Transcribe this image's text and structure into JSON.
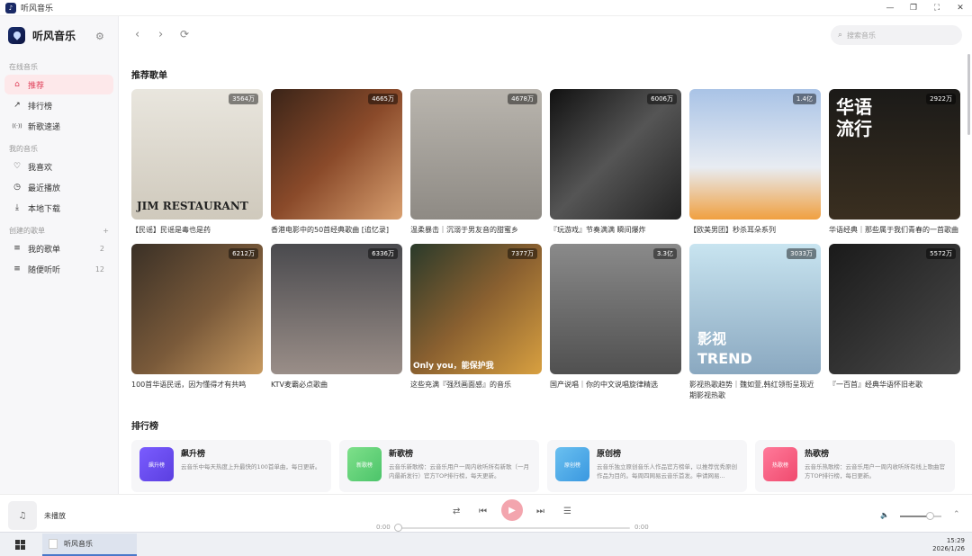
{
  "window": {
    "title": "听风音乐",
    "controls": [
      "—",
      "❐",
      "⛶",
      "✕"
    ]
  },
  "app": {
    "name": "听风音乐"
  },
  "sidebar": {
    "sections": [
      {
        "label": "在线音乐",
        "items": [
          {
            "label": "推荐",
            "icon": "home-icon",
            "active": true
          },
          {
            "label": "排行榜",
            "icon": "trend-icon"
          },
          {
            "label": "新歌速递",
            "icon": "broadcast-icon"
          }
        ]
      },
      {
        "label": "我的音乐",
        "items": [
          {
            "label": "我喜欢",
            "icon": "heart-icon"
          },
          {
            "label": "最近播放",
            "icon": "clock-icon"
          },
          {
            "label": "本地下载",
            "icon": "download-icon"
          }
        ]
      },
      {
        "label": "创建的歌单",
        "add": "+",
        "items": [
          {
            "label": "我的歌单",
            "icon": "playlist-icon",
            "count": "2"
          },
          {
            "label": "随便听听",
            "icon": "playlist-icon",
            "count": "12"
          }
        ]
      }
    ]
  },
  "search": {
    "placeholder": "搜索音乐"
  },
  "recommend": {
    "title": "推荐歌单",
    "row1": [
      {
        "title": "【民谣】民谣是毒也是药",
        "plays": "3564万",
        "overlay": "JIM RESTAURANT",
        "bg": "linear-gradient(180deg,#e9e6de,#cfc9bc)",
        "ov_color": "#222"
      },
      {
        "title": "香港电影中的50首经典歌曲 [追忆录]",
        "plays": "4665万",
        "overlay": "",
        "bg": "linear-gradient(135deg,#3a2418,#8a4a2a 50%,#d9a070)",
        "ov_color": "#fff"
      },
      {
        "title": "温柔暴击｜沉溺于男友音的甜蜜乡",
        "plays": "4678万",
        "overlay": "",
        "bg": "linear-gradient(180deg,#b9b5ae,#8e8a84)",
        "ov_color": "#fff"
      },
      {
        "title": "『玩游戏』节奏满满 瞬间爆炸",
        "plays": "6006万",
        "overlay": "",
        "bg": "linear-gradient(135deg,#111,#555 50%,#222)",
        "ov_color": "#fff"
      },
      {
        "title": "【欧美男团】秒杀耳朵系列",
        "plays": "1.4亿",
        "overlay": "",
        "bg": "linear-gradient(180deg,#a9c3e6,#e8ecf2 60%,#f0a040)",
        "ov_color": "#fff"
      },
      {
        "title": "华语经典｜那些属于我们青春的一首歌曲",
        "plays": "2922万",
        "overlay": "华语\n流行",
        "bg": "linear-gradient(180deg,#1b1a18,#3a2f20)",
        "ov_color": "#fff"
      }
    ],
    "row2": [
      {
        "title": "100首华语民谣，因为懂得才有共鸣",
        "plays": "6212万",
        "overlay": "",
        "bg": "linear-gradient(135deg,#3a3026,#7a5a3a 55%,#c89a60)",
        "ov_color": "#fff"
      },
      {
        "title": "KTV麦霸必点歌曲",
        "plays": "6336万",
        "overlay": "",
        "bg": "linear-gradient(180deg,#4a4a4e,#9a8e88)",
        "ov_color": "#fff"
      },
      {
        "title": "这些充满『强烈画面感』的音乐",
        "plays": "7377万",
        "overlay": "Only you，能保护我",
        "bg": "linear-gradient(135deg,#2a3a2a,#8a6030 50%,#d8a040)",
        "ov_color": "#fff"
      },
      {
        "title": "国产说唱｜你的中文说唱旋律精选",
        "plays": "3.3亿",
        "overlay": "",
        "bg": "linear-gradient(180deg,#8a8a8a,#505050)",
        "ov_color": "#fff"
      },
      {
        "title": "影视热歌趋势｜魏如萱,韩红领衔呈现近期影视热歌",
        "plays": "3033万",
        "overlay": "影视\nTREND",
        "bg": "linear-gradient(180deg,#c8e4f0,#8aa8c0)",
        "ov_color": "#fff"
      },
      {
        "title": "『一百首』经典华语怀旧老歌",
        "plays": "5572万",
        "overlay": "",
        "bg": "linear-gradient(135deg,#1a1a1a,#4a4a4a)",
        "ov_color": "#fff"
      }
    ]
  },
  "ranking": {
    "title": "排行榜",
    "items": [
      {
        "name": "飙升榜",
        "thumb": "飙升榜",
        "desc": "云音乐中每天热度上升最快的100首单曲，每日更新。",
        "color": "linear-gradient(135deg,#7a5cff,#5b3fe0)"
      },
      {
        "name": "新歌榜",
        "thumb": "新歌榜",
        "desc": "云音乐新歌榜：云音乐用户一周内收听所有新歌（一月内最新发行）官方TOP排行榜，每天更新。",
        "color": "linear-gradient(135deg,#7ee08a,#4cc46a)"
      },
      {
        "name": "原创榜",
        "thumb": "原创榜",
        "desc": "云音乐独立原创音乐人作品官方榜单，以推荐优秀原创作品为目的。每周四网易云音乐首发。申请网易...",
        "color": "linear-gradient(135deg,#6ac0f0,#3a98e0)"
      },
      {
        "name": "热歌榜",
        "thumb": "热歌榜",
        "desc": "云音乐热歌榜：云音乐用户一周内收听所有线上歌曲官方TOP排行榜，每日更新。",
        "color": "linear-gradient(135deg,#ff7a9a,#f04a6e)"
      }
    ]
  },
  "player": {
    "status": "未播放",
    "time_current": "0:00",
    "time_total": "0:00",
    "progress": 0,
    "volume": 0.72
  },
  "taskbar": {
    "app": "听风音乐",
    "time": "15:29",
    "date": "2026/1/26"
  }
}
